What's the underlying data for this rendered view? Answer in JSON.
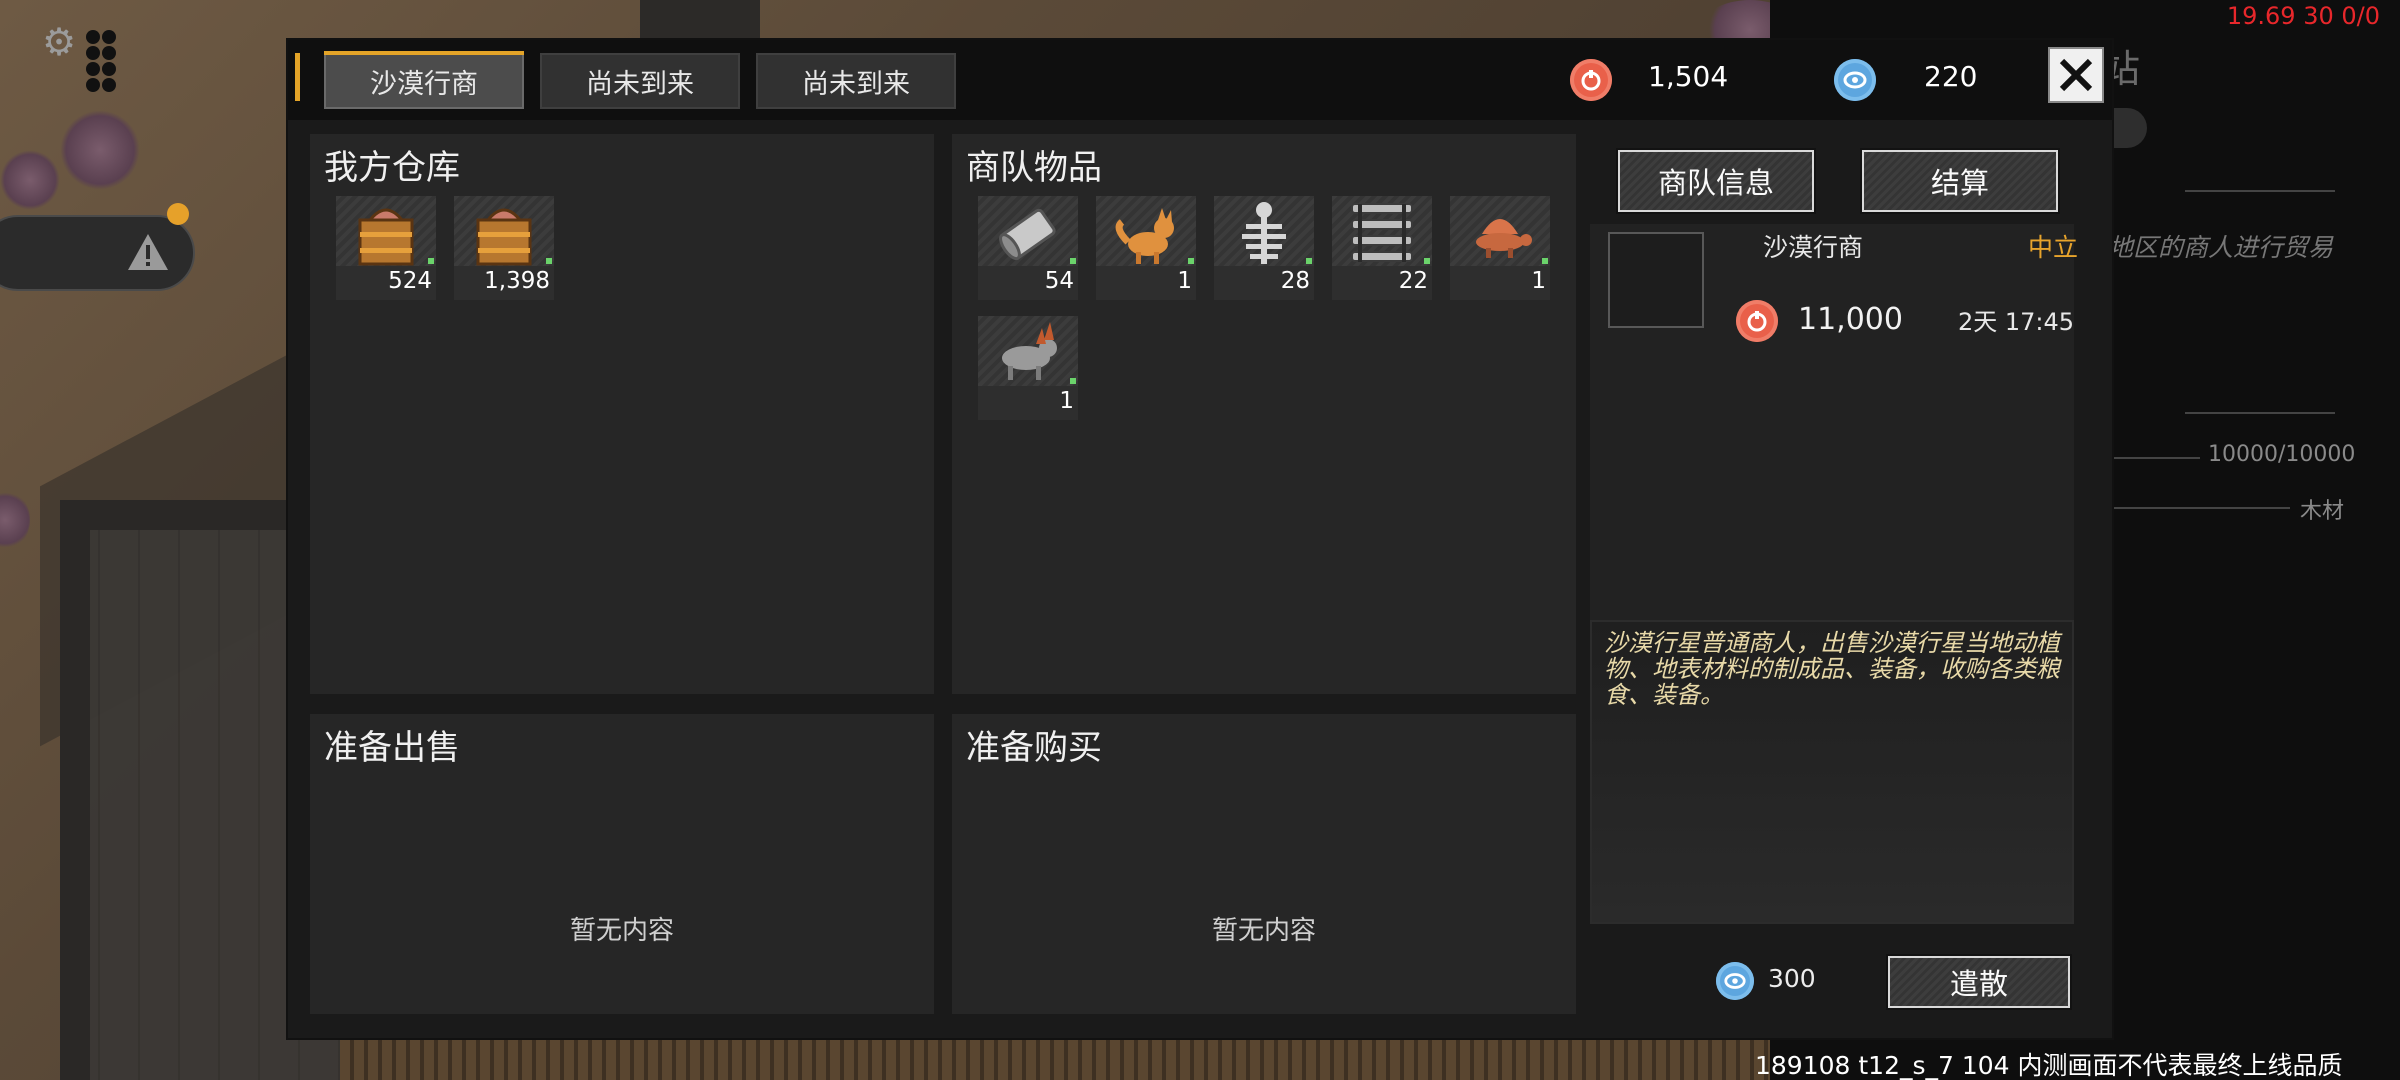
{
  "system": {
    "fps_readout": "19.69 30 0/0",
    "build_watermark": "189108 t12_s_7 104  内测画面不代表最终上线品质"
  },
  "background_hud": {
    "station_partial": "站",
    "trade_partial": "地区的商人进行贸易",
    "capacity": "10000/10000",
    "material": "木材"
  },
  "dialog": {
    "tabs": [
      {
        "label": "沙漠行商",
        "active": true
      },
      {
        "label": "尚未到来",
        "active": false
      },
      {
        "label": "尚未到来",
        "active": false
      }
    ],
    "currencies": {
      "red_coin": {
        "icon": "red-coin-icon",
        "value": "1,504",
        "color": "#e9604a"
      },
      "blue_coin": {
        "icon": "blue-coin-icon",
        "value": "220",
        "color": "#5da6df"
      }
    },
    "close_icon": "close-icon",
    "my_storage": {
      "title": "我方仓库",
      "items": [
        {
          "icon": "wooden-crate-icon",
          "qty": "524"
        },
        {
          "icon": "wooden-crate-icon",
          "qty": "1,398"
        }
      ]
    },
    "caravan_goods": {
      "title": "商队物品",
      "items": [
        {
          "icon": "metal-canister-icon",
          "qty": "54"
        },
        {
          "icon": "fox-creature-icon",
          "qty": "1"
        },
        {
          "icon": "skeleton-icon",
          "qty": "28"
        },
        {
          "icon": "pipe-stack-icon",
          "qty": "22"
        },
        {
          "icon": "sail-lizard-icon",
          "qty": "1"
        },
        {
          "icon": "horned-beast-icon",
          "qty": "1"
        }
      ]
    },
    "prepare_sell": {
      "title": "准备出售",
      "empty": "暂无内容"
    },
    "prepare_buy": {
      "title": "准备购买",
      "empty": "暂无内容"
    },
    "buttons": {
      "caravan_info": "商队信息",
      "settle": "结算",
      "disband": "遣散"
    },
    "merchant": {
      "name": "沙漠行商",
      "status": "中立",
      "money": "11,000",
      "time_left": "2天 17:45",
      "description": "沙漠行星普通商人，出售沙漠行星当地动植物、地表材料的制成品、装备，收购各类粮食、装备。"
    },
    "disband_cost": "300"
  },
  "colors": {
    "accent": "#e4a428",
    "panel": "#262626",
    "dialog_bg": "#1a1a1a"
  }
}
